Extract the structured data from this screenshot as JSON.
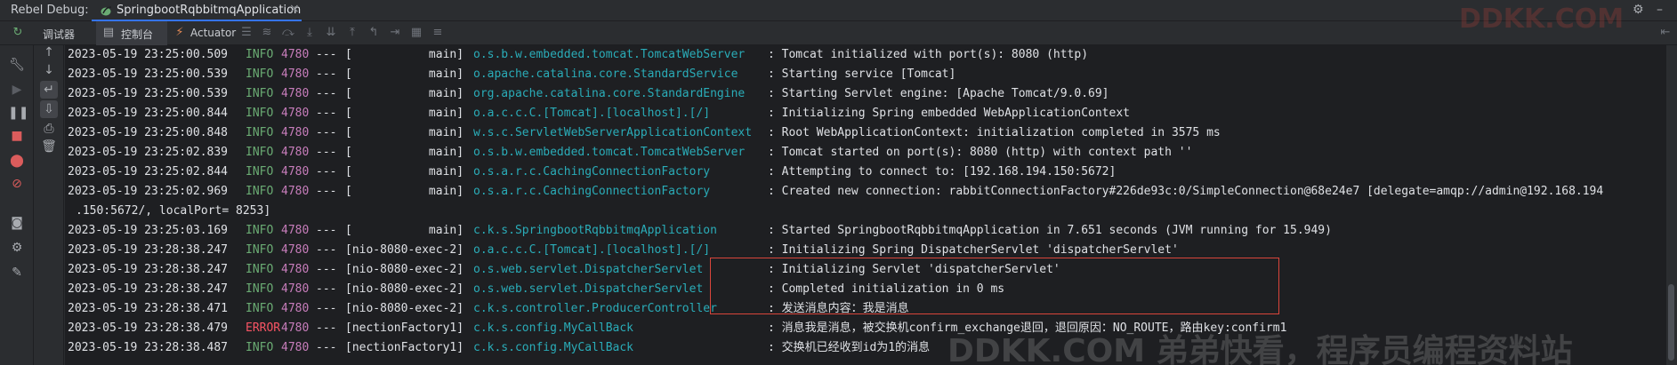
{
  "titlebar": {
    "label": "Rebel Debug:",
    "tab_title": "SpringbootRqbbitmqApplication",
    "close": "×",
    "gear": "⚙",
    "minimize": "–"
  },
  "toolbar": {
    "debugger_label": "调试器",
    "console_label": "控制台",
    "actuator_label": "Actuator"
  },
  "console": {
    "lines": [
      {
        "ts": "2023-05-19 23:25:00.509",
        "level": "INFO",
        "pid": "4780",
        "sep": "---",
        "thread": "[           main]",
        "logger": "o.s.b.w.embedded.tomcat.TomcatWebServer",
        "msg": ": Tomcat initialized with port(s): 8080 (http)"
      },
      {
        "ts": "2023-05-19 23:25:00.539",
        "level": "INFO",
        "pid": "4780",
        "sep": "---",
        "thread": "[           main]",
        "logger": "o.apache.catalina.core.StandardService",
        "msg": ": Starting service [Tomcat]"
      },
      {
        "ts": "2023-05-19 23:25:00.539",
        "level": "INFO",
        "pid": "4780",
        "sep": "---",
        "thread": "[           main]",
        "logger": "org.apache.catalina.core.StandardEngine",
        "msg": ": Starting Servlet engine: [Apache Tomcat/9.0.69]"
      },
      {
        "ts": "2023-05-19 23:25:00.844",
        "level": "INFO",
        "pid": "4780",
        "sep": "---",
        "thread": "[           main]",
        "logger": "o.a.c.c.C.[Tomcat].[localhost].[/]",
        "msg": ": Initializing Spring embedded WebApplicationContext"
      },
      {
        "ts": "2023-05-19 23:25:00.848",
        "level": "INFO",
        "pid": "4780",
        "sep": "---",
        "thread": "[           main]",
        "logger": "w.s.c.ServletWebServerApplicationContext",
        "msg": ": Root WebApplicationContext: initialization completed in 3575 ms"
      },
      {
        "ts": "2023-05-19 23:25:02.839",
        "level": "INFO",
        "pid": "4780",
        "sep": "---",
        "thread": "[           main]",
        "logger": "o.s.b.w.embedded.tomcat.TomcatWebServer",
        "msg": ": Tomcat started on port(s): 8080 (http) with context path ''"
      },
      {
        "ts": "2023-05-19 23:25:02.844",
        "level": "INFO",
        "pid": "4780",
        "sep": "---",
        "thread": "[           main]",
        "logger": "o.s.a.r.c.CachingConnectionFactory",
        "msg": ": Attempting to connect to: [192.168.194.150:5672]"
      },
      {
        "ts": "2023-05-19 23:25:02.969",
        "level": "INFO",
        "pid": "4780",
        "sep": "---",
        "thread": "[           main]",
        "logger": "o.s.a.r.c.CachingConnectionFactory",
        "msg": ": Created new connection: rabbitConnectionFactory#226de93c:0/SimpleConnection@68e24e7 [delegate=amqp://admin@192.168.194"
      },
      {
        "wrap": ".150:5672/, localPort= 8253]"
      },
      {
        "ts": "2023-05-19 23:25:03.169",
        "level": "INFO",
        "pid": "4780",
        "sep": "---",
        "thread": "[           main]",
        "logger": "c.k.s.SpringbootRqbbitmqApplication",
        "msg": ": Started SpringbootRqbbitmqApplication in 7.651 seconds (JVM running for 15.949)"
      },
      {
        "ts": "2023-05-19 23:28:38.247",
        "level": "INFO",
        "pid": "4780",
        "sep": "---",
        "thread": "[nio-8080-exec-2]",
        "logger": "o.a.c.c.C.[Tomcat].[localhost].[/]",
        "msg": ": Initializing Spring DispatcherServlet 'dispatcherServlet'"
      },
      {
        "ts": "2023-05-19 23:28:38.247",
        "level": "INFO",
        "pid": "4780",
        "sep": "---",
        "thread": "[nio-8080-exec-2]",
        "logger": "o.s.web.servlet.DispatcherServlet",
        "msg": ": Initializing Servlet 'dispatcherServlet'"
      },
      {
        "ts": "2023-05-19 23:28:38.247",
        "level": "INFO",
        "pid": "4780",
        "sep": "---",
        "thread": "[nio-8080-exec-2]",
        "logger": "o.s.web.servlet.DispatcherServlet",
        "msg": ": Completed initialization in 0 ms"
      },
      {
        "ts": "2023-05-19 23:28:38.471",
        "level": "INFO",
        "pid": "4780",
        "sep": "---",
        "thread": "[nio-8080-exec-2]",
        "logger": "c.k.s.controller.ProducerController",
        "msg": ": 发送消息内容：我是消息"
      },
      {
        "ts": "2023-05-19 23:28:38.479",
        "level": "ERROR",
        "pid": "4780",
        "sep": "---",
        "thread": "[nectionFactory1]",
        "logger": "c.k.s.config.MyCallBack",
        "msg": ": 消息我是消息，被交换机confirm_exchange退回，退回原因：NO_ROUTE，路由key:confirm1"
      },
      {
        "ts": "2023-05-19 23:28:38.487",
        "level": "INFO",
        "pid": "4780",
        "sep": "---",
        "thread": "[nectionFactory1]",
        "logger": "c.k.s.config.MyCallBack",
        "msg": ": 交换机已经收到id为1的消息"
      }
    ]
  },
  "watermarks": {
    "top": "DDKK.COM",
    "bottom": "DDKK.COM 弟弟快看，程序员编程资料站"
  },
  "colors": {
    "bg": "#2b2d30",
    "console_bg": "#1e1f22",
    "info": "#6aab73",
    "error": "#f75464",
    "pid": "#c77dbb",
    "logger": "#2aacb8",
    "highlight": "#d9453b",
    "accent": "#3574f0"
  }
}
